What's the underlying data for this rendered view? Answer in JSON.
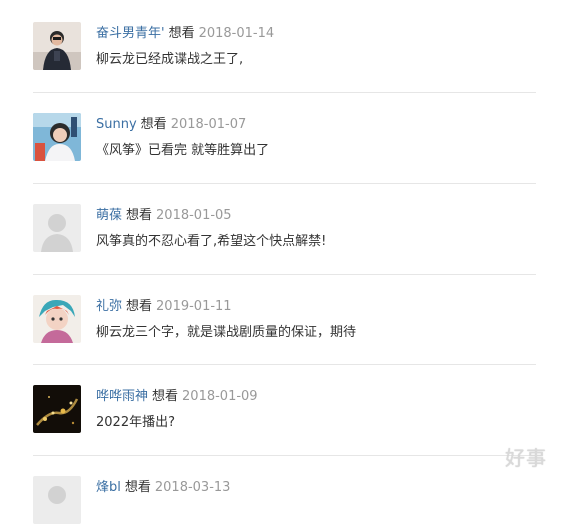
{
  "comments": [
    {
      "user": "奋斗男青年'",
      "verb": "想看",
      "date": "2018-01-14",
      "text": "柳云龙已经成谍战之王了,",
      "avatar": "avatar-man-dark-jacket"
    },
    {
      "user": "Sunny",
      "verb": "想看",
      "date": "2018-01-07",
      "text": "《风筝》已看完 就等胜算出了",
      "avatar": "avatar-woman-blue"
    },
    {
      "user": "萌葆",
      "verb": "想看",
      "date": "2018-01-05",
      "text": "风筝真的不忍心看了,希望这个快点解禁!",
      "avatar": "avatar-default-silhouette"
    },
    {
      "user": "礼弥",
      "verb": "想看",
      "date": "2019-01-11",
      "text": "柳云龙三个字，就是谍战剧质量的保证，期待",
      "avatar": "avatar-anime-girl"
    },
    {
      "user": "哗哗雨神",
      "verb": "想看",
      "date": "2018-01-09",
      "text": "2022年播出?",
      "avatar": "avatar-night-sparkles"
    },
    {
      "user": "烽bl",
      "verb": "想看",
      "date": "2018-03-13",
      "text": "",
      "avatar": "avatar-default-silhouette"
    }
  ],
  "watermark": "好事"
}
